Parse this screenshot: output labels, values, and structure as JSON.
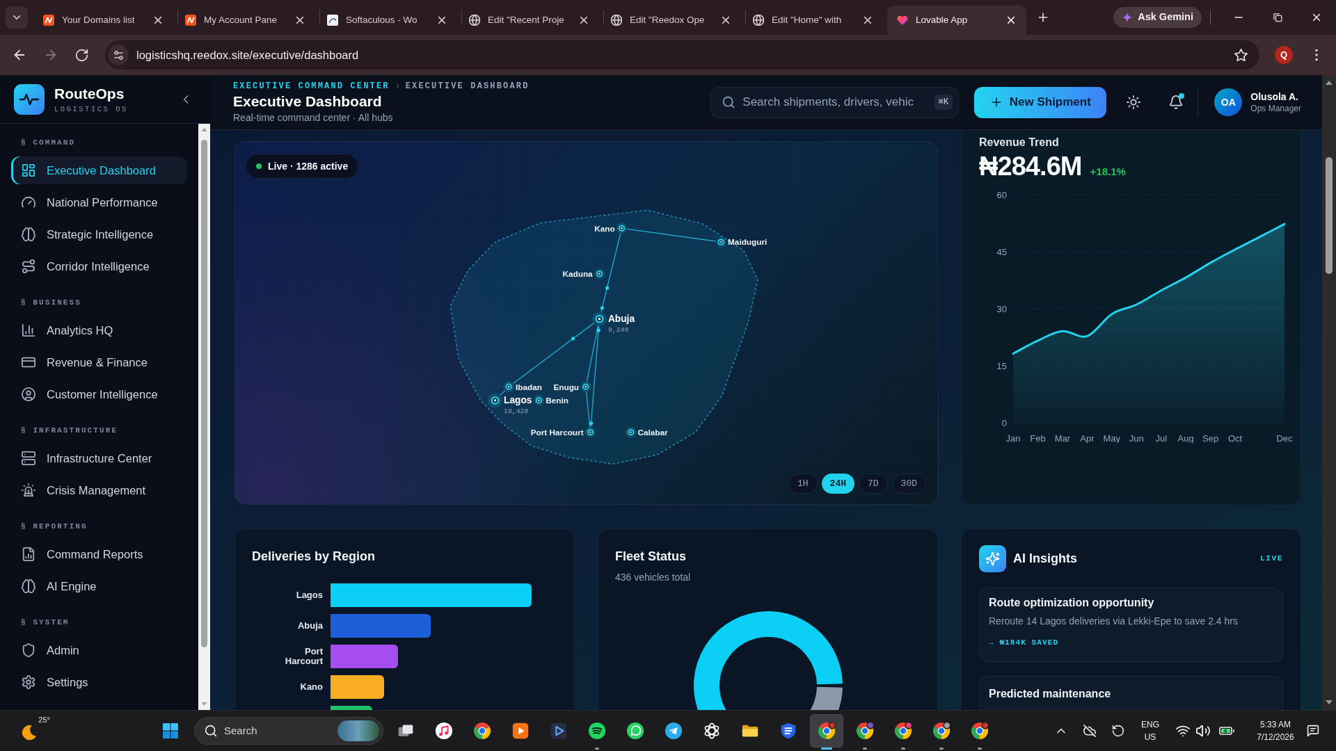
{
  "browser": {
    "tabs": [
      {
        "title": "Your Domains list",
        "selected": false
      },
      {
        "title": "My Account Pane",
        "selected": false
      },
      {
        "title": "Softaculous - Wo",
        "selected": false
      },
      {
        "title": "Edit \"Recent Proje",
        "selected": false
      },
      {
        "title": "Edit \"Reedox Ope",
        "selected": false
      },
      {
        "title": "Edit \"Home\" with",
        "selected": false
      },
      {
        "title": "Lovable App",
        "selected": true
      }
    ],
    "gemini_button": "Ask Gemini",
    "url": "logisticshq.reedox.site/executive/dashboard",
    "profile_initial": "Q"
  },
  "sidebar": {
    "brand": "RouteOps",
    "tagline": "LOGISTICS OS",
    "sections": [
      {
        "title": "§ COMMAND",
        "items": [
          {
            "label": "Executive Dashboard",
            "selected": true
          },
          {
            "label": "National Performance",
            "selected": false
          },
          {
            "label": "Strategic Intelligence",
            "selected": false
          },
          {
            "label": "Corridor Intelligence",
            "selected": false
          }
        ]
      },
      {
        "title": "§ BUSINESS",
        "items": [
          {
            "label": "Analytics HQ",
            "selected": false
          },
          {
            "label": "Revenue & Finance",
            "selected": false
          },
          {
            "label": "Customer Intelligence",
            "selected": false
          }
        ]
      },
      {
        "title": "§ INFRASTRUCTURE",
        "items": [
          {
            "label": "Infrastructure Center",
            "selected": false
          },
          {
            "label": "Crisis Management",
            "selected": false
          }
        ]
      },
      {
        "title": "§ REPORTING",
        "items": [
          {
            "label": "Command Reports",
            "selected": false
          },
          {
            "label": "AI Engine",
            "selected": false
          }
        ]
      },
      {
        "title": "§ SYSTEM",
        "items": [
          {
            "label": "Admin",
            "selected": false
          },
          {
            "label": "Settings",
            "selected": false
          }
        ]
      }
    ]
  },
  "header": {
    "breadcrumb": [
      "EXECUTIVE COMMAND CENTER",
      "EXECUTIVE DASHBOARD"
    ],
    "title": "Executive Dashboard",
    "subtitle": "Real-time command center · All hubs",
    "search": {
      "placeholder": "Search shipments, drivers, vehic",
      "shortcut": "⌘K"
    },
    "new_button": "New Shipment",
    "notifications": {
      "unread": true
    },
    "user": {
      "initials": "OA",
      "name": "Olusola A.",
      "role": "Ops Manager"
    }
  },
  "map": {
    "live": {
      "label": "Live · 1286 active",
      "on": true
    },
    "cities": [
      {
        "name": "Kano",
        "kind": "city"
      },
      {
        "name": "Maiduguri",
        "kind": "city"
      },
      {
        "name": "Kaduna",
        "kind": "city"
      },
      {
        "name": "Abuja",
        "kind": "hub",
        "count": "9,240"
      },
      {
        "name": "Ibadan",
        "kind": "city"
      },
      {
        "name": "Lagos",
        "kind": "hub",
        "count": "18,420"
      },
      {
        "name": "Benin",
        "kind": "city"
      },
      {
        "name": "Enugu",
        "kind": "city"
      },
      {
        "name": "Port Harcourt",
        "kind": "city"
      },
      {
        "name": "Calabar",
        "kind": "city"
      }
    ],
    "ranges": [
      {
        "label": "1H",
        "selected": false
      },
      {
        "label": "24H",
        "selected": true
      },
      {
        "label": "7D",
        "selected": false
      },
      {
        "label": "30D",
        "selected": false
      }
    ]
  },
  "revenue": {
    "title": "Revenue Trend",
    "amount": "₦284.6M",
    "change": "+18.1%",
    "chart_data": {
      "type": "area",
      "categories": [
        "Jan",
        "Feb",
        "Mar",
        "Apr",
        "May",
        "Jun",
        "Jul",
        "Aug",
        "Sep",
        "Oct",
        null,
        "Dec"
      ],
      "series": [
        {
          "color": "#22d3ee",
          "values": [
            18.2,
            21.6,
            24.1,
            22.8,
            28.6,
            31.1,
            34.8,
            38.2,
            42.1,
            45.6,
            48.9,
            52.3
          ]
        }
      ],
      "ylim": [
        0,
        60
      ],
      "yticks": [
        0,
        15,
        30,
        45,
        60
      ],
      "grid": true
    }
  },
  "deliveries": {
    "title": "Deliveries by Region",
    "regions": [
      {
        "label": "Lagos",
        "color": "#0ccff5"
      },
      {
        "label": "Abuja",
        "color": "#1d5fd8"
      },
      {
        "label": "Port Harcourt",
        "color": "#a64df0"
      },
      {
        "label": "Kano",
        "color": "#f9ad22"
      },
      {
        "color": "#20c26a"
      }
    ]
  },
  "fleet": {
    "title": "Fleet Status",
    "subtitle": "436 vehicles total"
  },
  "insights": {
    "title": "AI Insights",
    "badge": "LIVE",
    "items": [
      {
        "title": "Route optimization opportunity",
        "description": "Reroute 14 Lagos deliveries via Lekki-Epe to save 2.4 hrs",
        "impact": "→ ₦184K SAVED"
      },
      {
        "title": "Predicted maintenance"
      }
    ]
  },
  "taskbar": {
    "weather": "25°",
    "search": "Search",
    "apps": [
      {
        "running": false,
        "selected": false
      },
      {
        "running": false,
        "selected": false
      },
      {
        "running": false,
        "selected": false
      },
      {
        "running": false,
        "selected": false
      },
      {
        "running": true,
        "selected": false
      },
      {
        "running": false,
        "selected": false
      },
      {
        "running": false,
        "selected": false
      },
      {
        "running": false,
        "selected": false
      },
      {
        "running": false,
        "selected": false
      },
      {
        "running": false,
        "selected": false
      },
      {
        "running": true,
        "selected": true
      },
      {
        "running": true,
        "selected": false
      },
      {
        "running": true,
        "selected": false
      },
      {
        "running": true,
        "selected": false
      },
      {
        "running": true,
        "selected": false
      }
    ],
    "language": [
      "ENG",
      "US"
    ],
    "time": "5:33 AM",
    "date": "7/12/2026"
  }
}
